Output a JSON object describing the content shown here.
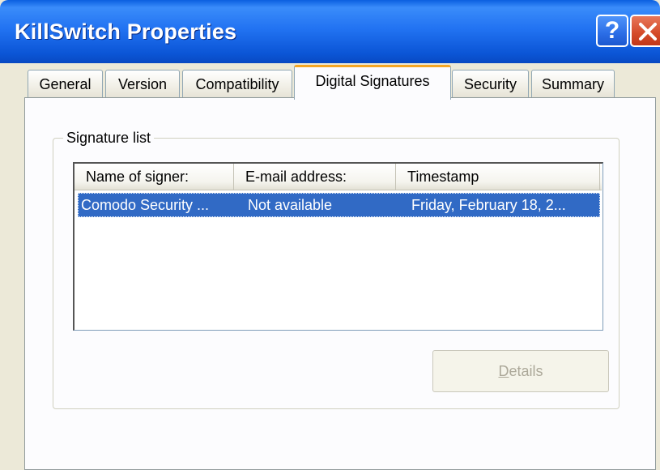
{
  "window": {
    "title": "KillSwitch Properties",
    "help_glyph": "?",
    "icons": [
      "help-icon",
      "close-icon"
    ],
    "colors": {
      "titlebar": "#2273f2",
      "close": "#d44a28",
      "active_tab_accent": "#f5a623",
      "selection": "#316ac5"
    }
  },
  "tabs": [
    {
      "label": "General",
      "active": false
    },
    {
      "label": "Version",
      "active": false
    },
    {
      "label": "Compatibility",
      "active": false
    },
    {
      "label": "Digital Signatures",
      "active": true
    },
    {
      "label": "Security",
      "active": false
    },
    {
      "label": "Summary",
      "active": false
    }
  ],
  "signature_list": {
    "group_label": "Signature list",
    "columns": [
      "Name of signer:",
      "E-mail address:",
      "Timestamp"
    ],
    "rows": [
      {
        "name": "Comodo Security ...",
        "email": "Not available",
        "timestamp": "Friday, February 18, 2...",
        "selected": true
      }
    ]
  },
  "details_button": {
    "label_prefix": "D",
    "label_rest": "etails",
    "enabled": false
  }
}
